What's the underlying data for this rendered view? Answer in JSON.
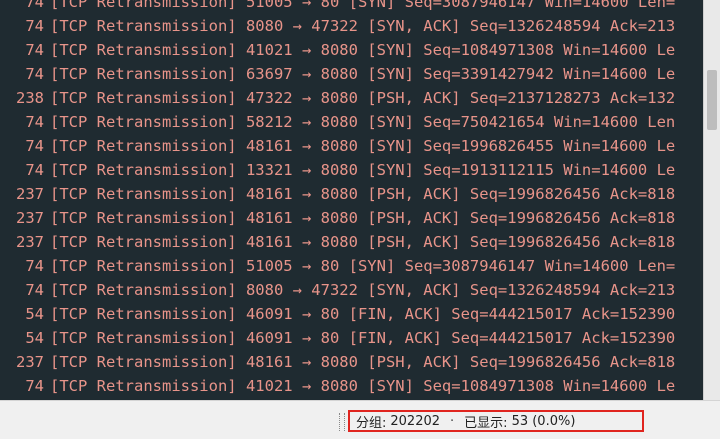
{
  "packet_list": {
    "rows": [
      {
        "length": "74",
        "info": "[TCP Retransmission] 51005 → 80 [SYN] Seq=3087946147 Win=14600 Len="
      },
      {
        "length": "74",
        "info": "[TCP Retransmission] 8080 → 47322 [SYN, ACK] Seq=1326248594 Ack=213"
      },
      {
        "length": "74",
        "info": "[TCP Retransmission] 41021 → 8080 [SYN] Seq=1084971308 Win=14600 Le"
      },
      {
        "length": "74",
        "info": "[TCP Retransmission] 63697 → 8080 [SYN] Seq=3391427942 Win=14600 Le"
      },
      {
        "length": "238",
        "info": "[TCP Retransmission] 47322 → 8080 [PSH, ACK] Seq=2137128273 Ack=132"
      },
      {
        "length": "74",
        "info": "[TCP Retransmission] 58212 → 8080 [SYN] Seq=750421654 Win=14600 Len"
      },
      {
        "length": "74",
        "info": "[TCP Retransmission] 48161 → 8080 [SYN] Seq=1996826455 Win=14600 Le"
      },
      {
        "length": "74",
        "info": "[TCP Retransmission] 13321 → 8080 [SYN] Seq=1913112115 Win=14600 Le"
      },
      {
        "length": "237",
        "info": "[TCP Retransmission] 48161 → 8080 [PSH, ACK] Seq=1996826456 Ack=818"
      },
      {
        "length": "237",
        "info": "[TCP Retransmission] 48161 → 8080 [PSH, ACK] Seq=1996826456 Ack=818"
      },
      {
        "length": "237",
        "info": "[TCP Retransmission] 48161 → 8080 [PSH, ACK] Seq=1996826456 Ack=818"
      },
      {
        "length": "74",
        "info": "[TCP Retransmission] 51005 → 80 [SYN] Seq=3087946147 Win=14600 Len="
      },
      {
        "length": "74",
        "info": "[TCP Retransmission] 8080 → 47322 [SYN, ACK] Seq=1326248594 Ack=213"
      },
      {
        "length": "54",
        "info": "[TCP Retransmission] 46091 → 80 [FIN, ACK] Seq=444215017 Ack=152390"
      },
      {
        "length": "54",
        "info": "[TCP Retransmission] 46091 → 80 [FIN, ACK] Seq=444215017 Ack=152390"
      },
      {
        "length": "237",
        "info": "[TCP Retransmission] 48161 → 8080 [PSH, ACK] Seq=1996826456 Ack=818"
      },
      {
        "length": "74",
        "info": "[TCP Retransmission] 41021 → 8080 [SYN] Seq=1084971308 Win=14600 Le"
      }
    ]
  },
  "statusbar": {
    "packets_label": "分组:",
    "packets_value": "202202",
    "separator": "·",
    "displayed_label": "已显示:",
    "displayed_value": "53 (0.0%)"
  },
  "colors": {
    "background": "#1f2b31",
    "text": "#e8948a",
    "highlight_box": "#e0251f"
  }
}
